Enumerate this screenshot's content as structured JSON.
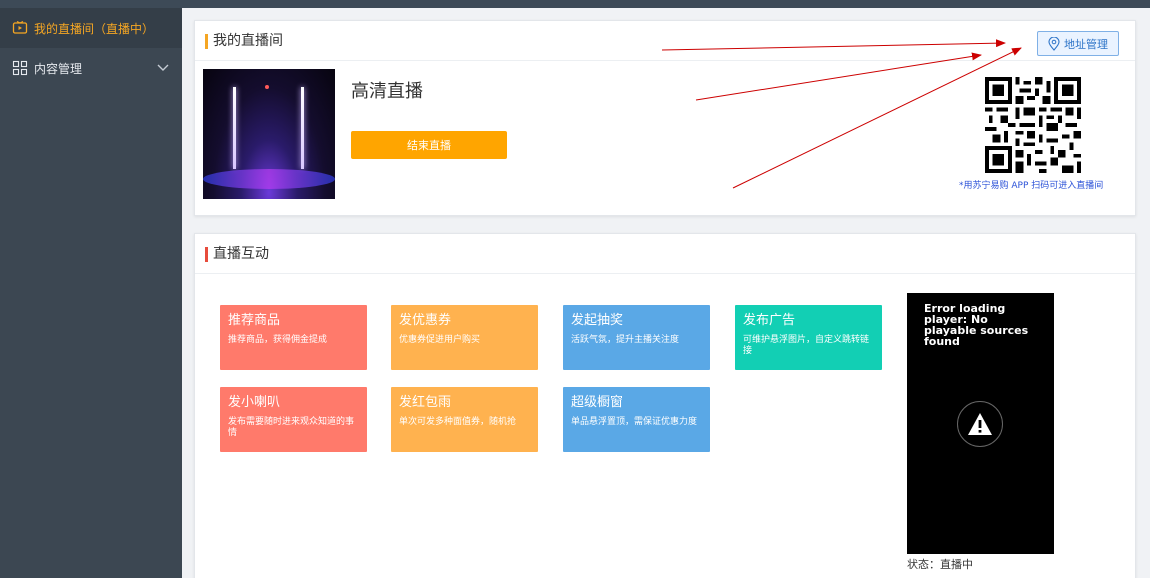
{
  "sidebar": {
    "items": [
      {
        "label": "我的直播间（直播中）",
        "icon": "tv-icon",
        "active": true
      },
      {
        "label": "内容管理",
        "icon": "grid-icon",
        "active": false
      }
    ]
  },
  "room_card": {
    "title": "我的直播间",
    "address_button": "地址管理",
    "live_title": "高清直播",
    "end_button": "结束直播",
    "qr_hint": "*用苏宁易购 APP 扫码可进入直播间"
  },
  "interact_card": {
    "title": "直播互动",
    "tiles": [
      {
        "title": "推荐商品",
        "desc": "推荐商品，获得佣金提成",
        "color": "#ff7a6b"
      },
      {
        "title": "发优惠券",
        "desc": "优惠券促进用户购买",
        "color": "#ffb24f"
      },
      {
        "title": "发起抽奖",
        "desc": "活跃气氛，提升主播关注度",
        "color": "#5aa8e6"
      },
      {
        "title": "发布广告",
        "desc": "可维护悬浮图片，自定义跳转链接",
        "color": "#12cfb4"
      },
      {
        "title": "发小喇叭",
        "desc": "发布需要随时进来观众知道的事情",
        "color": "#ff7a6b"
      },
      {
        "title": "发红包雨",
        "desc": "单次可发多种面值券，随机抢",
        "color": "#ffb24f"
      },
      {
        "title": "超级橱窗",
        "desc": "单品悬浮置顶，需保证优惠力度",
        "color": "#5aa8e6"
      }
    ],
    "player_error": "Error loading player: No playable sources found",
    "status": "状态：直播中"
  },
  "colors": {
    "accent": "#f5a623",
    "end_button": "#ffa500",
    "sidebar_bg": "#3c4752",
    "link_blue": "#2d74c8"
  }
}
